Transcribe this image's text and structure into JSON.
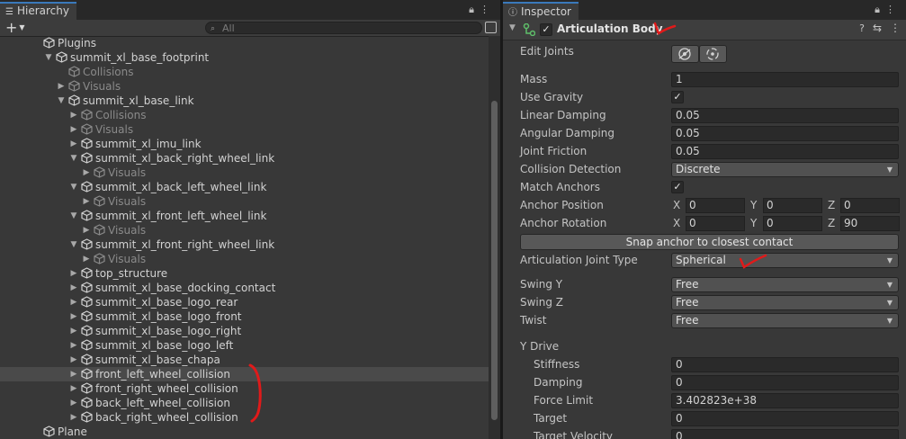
{
  "hierarchy": {
    "tab_label": "Hierarchy",
    "add_label": "+",
    "search_placeholder": "All",
    "rows": [
      {
        "label": "Plugins",
        "depth": 2,
        "arrow": "",
        "dim": false,
        "selected": false
      },
      {
        "label": "summit_xl_base_footprint",
        "depth": 3,
        "arrow": "down",
        "dim": false,
        "selected": false
      },
      {
        "label": "Collisions",
        "depth": 4,
        "arrow": "",
        "dim": true,
        "selected": false
      },
      {
        "label": "Visuals",
        "depth": 4,
        "arrow": "right",
        "dim": true,
        "selected": false
      },
      {
        "label": "summit_xl_base_link",
        "depth": 4,
        "arrow": "down",
        "dim": false,
        "selected": false
      },
      {
        "label": "Collisions",
        "depth": 5,
        "arrow": "right",
        "dim": true,
        "selected": false
      },
      {
        "label": "Visuals",
        "depth": 5,
        "arrow": "right",
        "dim": true,
        "selected": false
      },
      {
        "label": "summit_xl_imu_link",
        "depth": 5,
        "arrow": "right",
        "dim": false,
        "selected": false
      },
      {
        "label": "summit_xl_back_right_wheel_link",
        "depth": 5,
        "arrow": "down",
        "dim": false,
        "selected": false
      },
      {
        "label": "Visuals",
        "depth": 6,
        "arrow": "right",
        "dim": true,
        "selected": false
      },
      {
        "label": "summit_xl_back_left_wheel_link",
        "depth": 5,
        "arrow": "down",
        "dim": false,
        "selected": false
      },
      {
        "label": "Visuals",
        "depth": 6,
        "arrow": "right",
        "dim": true,
        "selected": false
      },
      {
        "label": "summit_xl_front_left_wheel_link",
        "depth": 5,
        "arrow": "down",
        "dim": false,
        "selected": false
      },
      {
        "label": "Visuals",
        "depth": 6,
        "arrow": "right",
        "dim": true,
        "selected": false
      },
      {
        "label": "summit_xl_front_right_wheel_link",
        "depth": 5,
        "arrow": "down",
        "dim": false,
        "selected": false
      },
      {
        "label": "Visuals",
        "depth": 6,
        "arrow": "right",
        "dim": true,
        "selected": false
      },
      {
        "label": "top_structure",
        "depth": 5,
        "arrow": "right",
        "dim": false,
        "selected": false
      },
      {
        "label": "summit_xl_base_docking_contact",
        "depth": 5,
        "arrow": "right",
        "dim": false,
        "selected": false
      },
      {
        "label": "summit_xl_base_logo_rear",
        "depth": 5,
        "arrow": "right",
        "dim": false,
        "selected": false
      },
      {
        "label": "summit_xl_base_logo_front",
        "depth": 5,
        "arrow": "right",
        "dim": false,
        "selected": false
      },
      {
        "label": "summit_xl_base_logo_right",
        "depth": 5,
        "arrow": "right",
        "dim": false,
        "selected": false
      },
      {
        "label": "summit_xl_base_logo_left",
        "depth": 5,
        "arrow": "right",
        "dim": false,
        "selected": false
      },
      {
        "label": "summit_xl_base_chapa",
        "depth": 5,
        "arrow": "right",
        "dim": false,
        "selected": false
      },
      {
        "label": "front_left_wheel_collision",
        "depth": 5,
        "arrow": "right",
        "dim": false,
        "selected": true
      },
      {
        "label": "front_right_wheel_collision",
        "depth": 5,
        "arrow": "right",
        "dim": false,
        "selected": false
      },
      {
        "label": "back_left_wheel_collision",
        "depth": 5,
        "arrow": "right",
        "dim": false,
        "selected": false
      },
      {
        "label": "back_right_wheel_collision",
        "depth": 5,
        "arrow": "right",
        "dim": false,
        "selected": false
      },
      {
        "label": "Plane",
        "depth": 2,
        "arrow": "",
        "dim": false,
        "selected": false
      }
    ]
  },
  "inspector": {
    "tab_label": "Inspector",
    "component": {
      "title": "Articulation Body",
      "enabled": true
    },
    "edit_joints_label": "Edit Joints",
    "mass": {
      "label": "Mass",
      "value": "1"
    },
    "use_gravity": {
      "label": "Use Gravity",
      "checked": true
    },
    "linear_damping": {
      "label": "Linear Damping",
      "value": "0.05"
    },
    "angular_damping": {
      "label": "Angular Damping",
      "value": "0.05"
    },
    "joint_friction": {
      "label": "Joint Friction",
      "value": "0.05"
    },
    "collision_detection": {
      "label": "Collision Detection",
      "value": "Discrete"
    },
    "match_anchors": {
      "label": "Match Anchors",
      "checked": true
    },
    "anchor_position": {
      "label": "Anchor Position",
      "x": "0",
      "y": "0",
      "z": "0"
    },
    "anchor_rotation": {
      "label": "Anchor Rotation",
      "x": "0",
      "y": "0",
      "z": "90"
    },
    "axis_labels": {
      "x": "X",
      "y": "Y",
      "z": "Z"
    },
    "snap_button": "Snap anchor to closest contact",
    "joint_type": {
      "label": "Articulation Joint Type",
      "value": "Spherical"
    },
    "swing_y": {
      "label": "Swing Y",
      "value": "Free"
    },
    "swing_z": {
      "label": "Swing Z",
      "value": "Free"
    },
    "twist": {
      "label": "Twist",
      "value": "Free"
    },
    "y_drive": {
      "label": "Y Drive",
      "stiffness": {
        "label": "Stiffness",
        "value": "0"
      },
      "damping": {
        "label": "Damping",
        "value": "0"
      },
      "force_limit": {
        "label": "Force Limit",
        "value": "3.402823e+38"
      },
      "target": {
        "label": "Target",
        "value": "0"
      },
      "target_velocity": {
        "label": "Target Velocity",
        "value": "0"
      }
    }
  },
  "colors": {
    "annotation_red": "#e01a1a",
    "tab_accent": "#3a79bb"
  }
}
